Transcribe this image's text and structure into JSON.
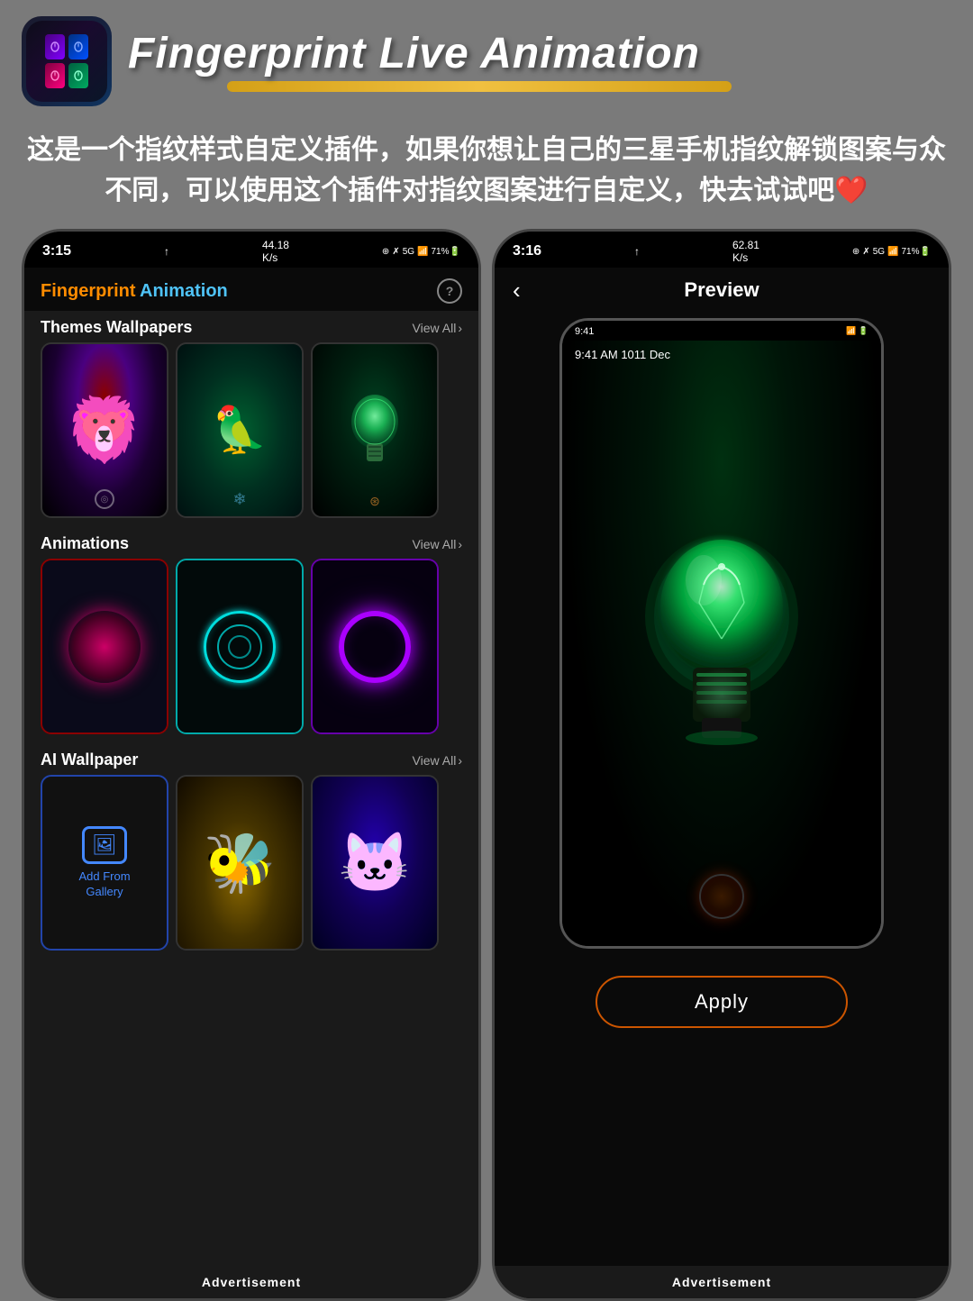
{
  "header": {
    "app_title": "Fingerprint Live Animation",
    "app_title_part1": "Fingerprint",
    "app_title_part2": " Live Animation"
  },
  "description": {
    "text": "这是一个指纹样式自定义插件，如果你想让自己的三星手机指纹解锁图案与众不同，可以使用这个插件对指纹图案进行自定义，快去试试吧❤️"
  },
  "left_phone": {
    "status_time": "3:15",
    "status_icons": "44.18 K/s ⊕ ✗ 5G 71%",
    "app_title_orange": "Fingerprint",
    "app_title_blue": " Animation",
    "sections": {
      "themes": {
        "title": "Themes Wallpapers",
        "view_all": "View All"
      },
      "animations": {
        "title": "Animations",
        "view_all": "View All"
      },
      "ai_wallpaper": {
        "title": "AI Wallpaper",
        "view_all": "View All"
      }
    },
    "add_gallery": "Add From\nGallery",
    "advertisement": "Advertisement"
  },
  "right_phone": {
    "status_time": "3:16",
    "status_icons": "62.81 K/s ⊕ ✗ 5G 71%",
    "preview_title": "Preview",
    "back_label": "‹",
    "inner_phone": {
      "status_time": "9:41",
      "time_display": "9:41 AM",
      "date_display": "1011 Dec"
    },
    "apply_button": "Apply",
    "advertisement": "Advertisement"
  }
}
